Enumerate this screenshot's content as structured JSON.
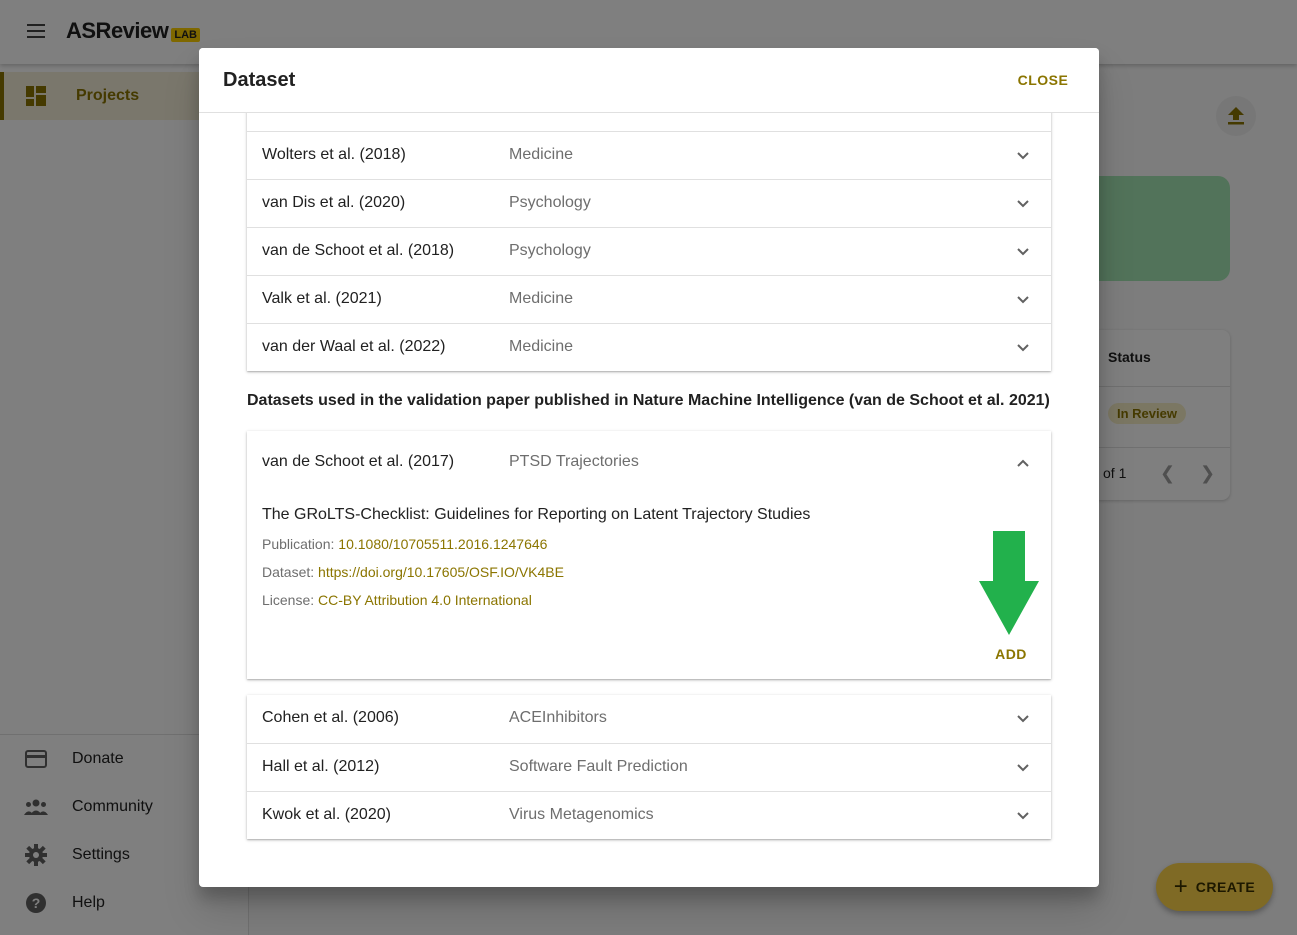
{
  "app": {
    "logo_main": "ASReview",
    "logo_badge": "LAB"
  },
  "sidebar": {
    "top_items": [
      {
        "label": "Projects",
        "icon": "dashboard-icon",
        "active": true
      }
    ],
    "bottom_items": [
      {
        "label": "Donate",
        "icon": "credit-card-icon"
      },
      {
        "label": "Community",
        "icon": "people-icon"
      },
      {
        "label": "Settings",
        "icon": "gear-icon"
      },
      {
        "label": "Help",
        "icon": "help-circle-icon"
      }
    ]
  },
  "background": {
    "table_header_status": "Status",
    "row_status_badge": "In Review",
    "pagination_text": "of 1",
    "create_button": "CREATE"
  },
  "dialog": {
    "title": "Dataset",
    "close_label": "CLOSE",
    "group1": [
      {
        "author": "Wolters et al. (2018)",
        "topic": "Medicine"
      },
      {
        "author": "van Dis et al. (2020)",
        "topic": "Psychology"
      },
      {
        "author": "van de Schoot et al. (2018)",
        "topic": "Psychology"
      },
      {
        "author": "Valk et al. (2021)",
        "topic": "Medicine"
      },
      {
        "author": "van der Waal et al. (2022)",
        "topic": "Medicine"
      }
    ],
    "section_note": "Datasets used in the validation paper published in Nature Machine Intelligence (van de Schoot et al. 2021)",
    "expanded": {
      "author": "van de Schoot et al. (2017)",
      "topic": "PTSD Trajectories",
      "title": "The GRoLTS-Checklist: Guidelines for Reporting on Latent Trajectory Studies",
      "publication_label": "Publication:",
      "publication_value": "10.1080/10705511.2016.1247646",
      "dataset_label": "Dataset:",
      "dataset_value": "https://doi.org/10.17605/OSF.IO/VK4BE",
      "license_label": "License:",
      "license_value": "CC-BY Attribution 4.0 International",
      "add_label": "ADD"
    },
    "group2": [
      {
        "author": "Cohen et al. (2006)",
        "topic": "ACEInhibitors"
      },
      {
        "author": "Hall et al. (2012)",
        "topic": "Software Fault Prediction"
      },
      {
        "author": "Kwok et al. (2020)",
        "topic": "Virus Metagenomics"
      }
    ]
  },
  "colors": {
    "accent": "#8b7500",
    "fab": "#ffd54a",
    "highlight_arrow": "#22b14c"
  }
}
